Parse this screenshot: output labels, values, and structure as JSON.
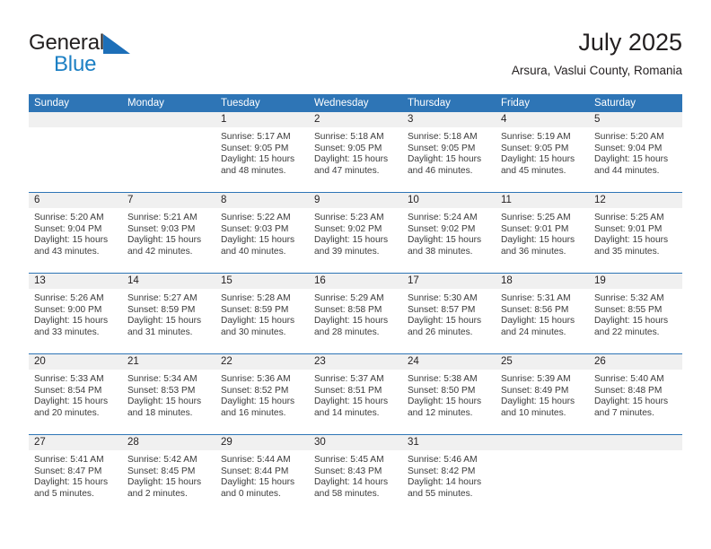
{
  "brand": {
    "name_top": "General",
    "name_bottom": "Blue",
    "triangle_icon": "blue-triangle-icon",
    "accent_dark": "#221f1f",
    "accent_blue": "#1d80c4"
  },
  "header": {
    "title": "July 2025",
    "subtitle": "Arsura, Vaslui County, Romania"
  },
  "colors": {
    "header_blue": "#2e75b6",
    "daynum_band": "#f0f0f0",
    "text": "#231f20"
  },
  "calendar": {
    "day_headers": [
      "Sunday",
      "Monday",
      "Tuesday",
      "Wednesday",
      "Thursday",
      "Friday",
      "Saturday"
    ],
    "weeks": [
      [
        {
          "day": "",
          "lines": []
        },
        {
          "day": "",
          "lines": []
        },
        {
          "day": "1",
          "lines": [
            "Sunrise: 5:17 AM",
            "Sunset: 9:05 PM",
            "Daylight: 15 hours",
            "and 48 minutes."
          ]
        },
        {
          "day": "2",
          "lines": [
            "Sunrise: 5:18 AM",
            "Sunset: 9:05 PM",
            "Daylight: 15 hours",
            "and 47 minutes."
          ]
        },
        {
          "day": "3",
          "lines": [
            "Sunrise: 5:18 AM",
            "Sunset: 9:05 PM",
            "Daylight: 15 hours",
            "and 46 minutes."
          ]
        },
        {
          "day": "4",
          "lines": [
            "Sunrise: 5:19 AM",
            "Sunset: 9:05 PM",
            "Daylight: 15 hours",
            "and 45 minutes."
          ]
        },
        {
          "day": "5",
          "lines": [
            "Sunrise: 5:20 AM",
            "Sunset: 9:04 PM",
            "Daylight: 15 hours",
            "and 44 minutes."
          ]
        }
      ],
      [
        {
          "day": "6",
          "lines": [
            "Sunrise: 5:20 AM",
            "Sunset: 9:04 PM",
            "Daylight: 15 hours",
            "and 43 minutes."
          ]
        },
        {
          "day": "7",
          "lines": [
            "Sunrise: 5:21 AM",
            "Sunset: 9:03 PM",
            "Daylight: 15 hours",
            "and 42 minutes."
          ]
        },
        {
          "day": "8",
          "lines": [
            "Sunrise: 5:22 AM",
            "Sunset: 9:03 PM",
            "Daylight: 15 hours",
            "and 40 minutes."
          ]
        },
        {
          "day": "9",
          "lines": [
            "Sunrise: 5:23 AM",
            "Sunset: 9:02 PM",
            "Daylight: 15 hours",
            "and 39 minutes."
          ]
        },
        {
          "day": "10",
          "lines": [
            "Sunrise: 5:24 AM",
            "Sunset: 9:02 PM",
            "Daylight: 15 hours",
            "and 38 minutes."
          ]
        },
        {
          "day": "11",
          "lines": [
            "Sunrise: 5:25 AM",
            "Sunset: 9:01 PM",
            "Daylight: 15 hours",
            "and 36 minutes."
          ]
        },
        {
          "day": "12",
          "lines": [
            "Sunrise: 5:25 AM",
            "Sunset: 9:01 PM",
            "Daylight: 15 hours",
            "and 35 minutes."
          ]
        }
      ],
      [
        {
          "day": "13",
          "lines": [
            "Sunrise: 5:26 AM",
            "Sunset: 9:00 PM",
            "Daylight: 15 hours",
            "and 33 minutes."
          ]
        },
        {
          "day": "14",
          "lines": [
            "Sunrise: 5:27 AM",
            "Sunset: 8:59 PM",
            "Daylight: 15 hours",
            "and 31 minutes."
          ]
        },
        {
          "day": "15",
          "lines": [
            "Sunrise: 5:28 AM",
            "Sunset: 8:59 PM",
            "Daylight: 15 hours",
            "and 30 minutes."
          ]
        },
        {
          "day": "16",
          "lines": [
            "Sunrise: 5:29 AM",
            "Sunset: 8:58 PM",
            "Daylight: 15 hours",
            "and 28 minutes."
          ]
        },
        {
          "day": "17",
          "lines": [
            "Sunrise: 5:30 AM",
            "Sunset: 8:57 PM",
            "Daylight: 15 hours",
            "and 26 minutes."
          ]
        },
        {
          "day": "18",
          "lines": [
            "Sunrise: 5:31 AM",
            "Sunset: 8:56 PM",
            "Daylight: 15 hours",
            "and 24 minutes."
          ]
        },
        {
          "day": "19",
          "lines": [
            "Sunrise: 5:32 AM",
            "Sunset: 8:55 PM",
            "Daylight: 15 hours",
            "and 22 minutes."
          ]
        }
      ],
      [
        {
          "day": "20",
          "lines": [
            "Sunrise: 5:33 AM",
            "Sunset: 8:54 PM",
            "Daylight: 15 hours",
            "and 20 minutes."
          ]
        },
        {
          "day": "21",
          "lines": [
            "Sunrise: 5:34 AM",
            "Sunset: 8:53 PM",
            "Daylight: 15 hours",
            "and 18 minutes."
          ]
        },
        {
          "day": "22",
          "lines": [
            "Sunrise: 5:36 AM",
            "Sunset: 8:52 PM",
            "Daylight: 15 hours",
            "and 16 minutes."
          ]
        },
        {
          "day": "23",
          "lines": [
            "Sunrise: 5:37 AM",
            "Sunset: 8:51 PM",
            "Daylight: 15 hours",
            "and 14 minutes."
          ]
        },
        {
          "day": "24",
          "lines": [
            "Sunrise: 5:38 AM",
            "Sunset: 8:50 PM",
            "Daylight: 15 hours",
            "and 12 minutes."
          ]
        },
        {
          "day": "25",
          "lines": [
            "Sunrise: 5:39 AM",
            "Sunset: 8:49 PM",
            "Daylight: 15 hours",
            "and 10 minutes."
          ]
        },
        {
          "day": "26",
          "lines": [
            "Sunrise: 5:40 AM",
            "Sunset: 8:48 PM",
            "Daylight: 15 hours",
            "and 7 minutes."
          ]
        }
      ],
      [
        {
          "day": "27",
          "lines": [
            "Sunrise: 5:41 AM",
            "Sunset: 8:47 PM",
            "Daylight: 15 hours",
            "and 5 minutes."
          ]
        },
        {
          "day": "28",
          "lines": [
            "Sunrise: 5:42 AM",
            "Sunset: 8:45 PM",
            "Daylight: 15 hours",
            "and 2 minutes."
          ]
        },
        {
          "day": "29",
          "lines": [
            "Sunrise: 5:44 AM",
            "Sunset: 8:44 PM",
            "Daylight: 15 hours",
            "and 0 minutes."
          ]
        },
        {
          "day": "30",
          "lines": [
            "Sunrise: 5:45 AM",
            "Sunset: 8:43 PM",
            "Daylight: 14 hours",
            "and 58 minutes."
          ]
        },
        {
          "day": "31",
          "lines": [
            "Sunrise: 5:46 AM",
            "Sunset: 8:42 PM",
            "Daylight: 14 hours",
            "and 55 minutes."
          ]
        },
        {
          "day": "",
          "lines": []
        },
        {
          "day": "",
          "lines": []
        }
      ]
    ]
  }
}
